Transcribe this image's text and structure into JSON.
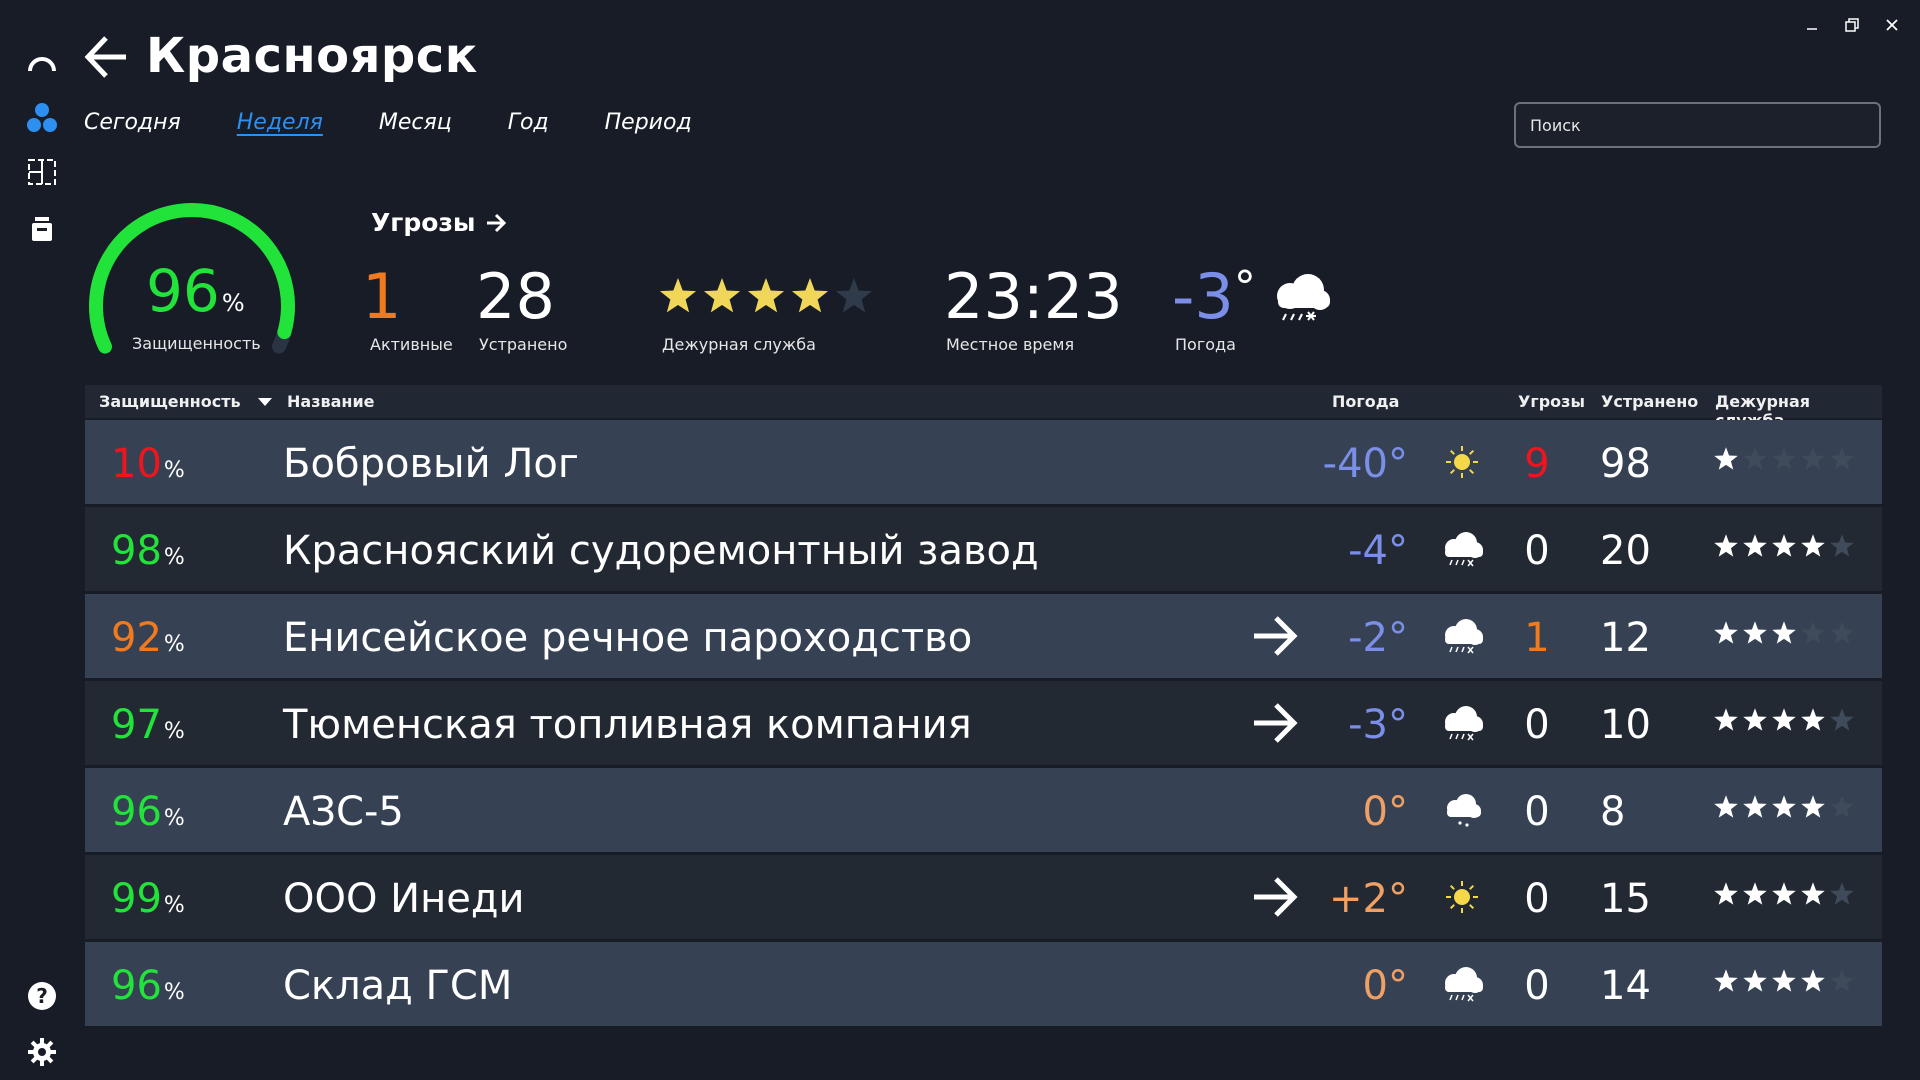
{
  "window": {
    "min_icon": "minimize-icon",
    "max_icon": "restore-icon",
    "close_icon": "close-icon"
  },
  "header": {
    "title": "Красноярск",
    "back_icon": "arrow-left-icon"
  },
  "tabs": [
    {
      "label": "Сегодня",
      "active": false
    },
    {
      "label": "Неделя",
      "active": true
    },
    {
      "label": "Месяц",
      "active": false
    },
    {
      "label": "Год",
      "active": false
    },
    {
      "label": "Период",
      "active": false
    }
  ],
  "search": {
    "placeholder": "Поиск",
    "value": ""
  },
  "summary": {
    "security": {
      "value": "96",
      "unit": "%",
      "label": "Защищенность",
      "fraction": 0.96
    },
    "threats_link": "Угрозы",
    "active": {
      "value": "1",
      "label": "Активные"
    },
    "fixed": {
      "value": "28",
      "label": "Устранено"
    },
    "duty": {
      "rating": 4,
      "max": 5,
      "label": "Дежурная служба"
    },
    "time": {
      "value": "23:23",
      "label": "Местное время"
    },
    "weather": {
      "value": "-3",
      "unit": "°",
      "label": "Погода",
      "icon": "snow-cloud-icon"
    }
  },
  "table": {
    "headers": {
      "security": "Защищенность",
      "name": "Название",
      "weather": "Погода",
      "threats": "Угрозы",
      "fixed": "Устранено",
      "duty": "Дежурная служба"
    },
    "rows": [
      {
        "pct": "10",
        "pct_color": "red",
        "name": "Бобровый Лог",
        "arrow": false,
        "temp": "-40°",
        "temp_color": "blue",
        "icon": "sun",
        "threats": "9",
        "threats_color": "red",
        "fixed": "98",
        "stars": 1
      },
      {
        "pct": "98",
        "pct_color": "green",
        "name": "Краснояский судоремонтный завод",
        "arrow": false,
        "temp": "-4°",
        "temp_color": "blue",
        "icon": "snow",
        "threats": "0",
        "threats_color": "white",
        "fixed": "20",
        "stars": 4
      },
      {
        "pct": "92",
        "pct_color": "orange",
        "name": "Енисейское речное пароходство",
        "arrow": true,
        "temp": "-2°",
        "temp_color": "blue",
        "icon": "snow",
        "threats": "1",
        "threats_color": "orange",
        "fixed": "12",
        "stars": 3
      },
      {
        "pct": "97",
        "pct_color": "green",
        "name": "Тюменская топливная компания",
        "arrow": true,
        "temp": "-3°",
        "temp_color": "blue",
        "icon": "snow",
        "threats": "0",
        "threats_color": "white",
        "fixed": "10",
        "stars": 4
      },
      {
        "pct": "96",
        "pct_color": "green",
        "name": "АЗС-5",
        "arrow": false,
        "temp": "0°",
        "temp_color": "warm",
        "icon": "light-snow",
        "threats": "0",
        "threats_color": "white",
        "fixed": "8",
        "stars": 4
      },
      {
        "pct": "99",
        "pct_color": "green",
        "name": "ООО Инеди",
        "arrow": true,
        "temp": "+2°",
        "temp_color": "warm",
        "icon": "sun",
        "threats": "0",
        "threats_color": "white",
        "fixed": "15",
        "stars": 4
      },
      {
        "pct": "96",
        "pct_color": "green",
        "name": "Склад ГСМ",
        "arrow": false,
        "temp": "0°",
        "temp_color": "warm",
        "icon": "snow",
        "threats": "0",
        "threats_color": "white",
        "fixed": "14",
        "stars": 4
      }
    ]
  },
  "sidebar": {
    "items": [
      {
        "icon": "arc-logo-icon"
      },
      {
        "icon": "cluster-icon"
      },
      {
        "icon": "board-icon"
      },
      {
        "icon": "archive-icon"
      }
    ],
    "bottom": [
      {
        "icon": "help-icon"
      },
      {
        "icon": "settings-icon"
      }
    ]
  },
  "colors": {
    "green": "#22e33a",
    "red": "#f0141e",
    "orange": "#f27a1e",
    "blue": "#7b8ee8",
    "warm": "#f0a064",
    "accent": "#2d8ff0",
    "star_on": "#f0d75a",
    "star_off": "#2f3a4a"
  }
}
